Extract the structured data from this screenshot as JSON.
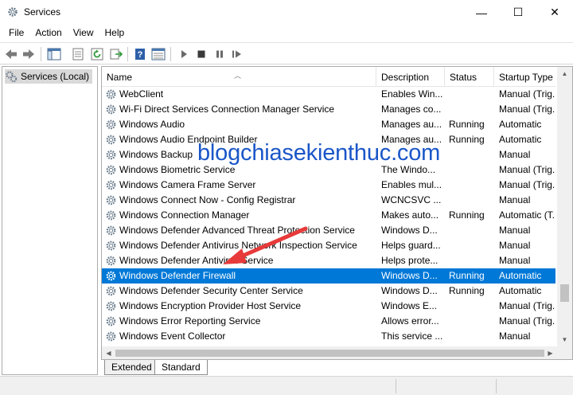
{
  "window": {
    "title": "Services",
    "icon": "gear-icon",
    "controls": {
      "minimize": "—",
      "maximize": "☐",
      "close": "✕"
    }
  },
  "menu": [
    "File",
    "Action",
    "View",
    "Help"
  ],
  "toolbar": {
    "icons": [
      "back-arrow-icon",
      "forward-arrow-icon",
      "show-hide-console-tree-icon",
      "properties-icon",
      "refresh-icon",
      "export-list-icon",
      "help-icon",
      "extended-view-icon",
      "start-service-icon",
      "stop-service-icon",
      "pause-service-icon",
      "restart-service-icon"
    ]
  },
  "tree": {
    "label": "Services (Local)"
  },
  "columns": [
    "Name",
    "Description",
    "Status",
    "Startup Type"
  ],
  "rows": [
    {
      "name": "WebClient",
      "description": "Enables Win...",
      "status": "",
      "startup": "Manual (Trig..."
    },
    {
      "name": "Wi-Fi Direct Services Connection Manager Service",
      "description": "Manages co...",
      "status": "",
      "startup": "Manual (Trig..."
    },
    {
      "name": "Windows Audio",
      "description": "Manages au...",
      "status": "Running",
      "startup": "Automatic"
    },
    {
      "name": "Windows Audio Endpoint Builder",
      "description": "Manages au...",
      "status": "Running",
      "startup": "Automatic"
    },
    {
      "name": "Windows Backup",
      "description": "",
      "status": "",
      "startup": "Manual"
    },
    {
      "name": "Windows Biometric Service",
      "description": "The Windo...",
      "status": "",
      "startup": "Manual (Trig..."
    },
    {
      "name": "Windows Camera Frame Server",
      "description": "Enables mul...",
      "status": "",
      "startup": "Manual (Trig..."
    },
    {
      "name": "Windows Connect Now - Config Registrar",
      "description": "WCNCSVC ...",
      "status": "",
      "startup": "Manual"
    },
    {
      "name": "Windows Connection Manager",
      "description": "Makes auto...",
      "status": "Running",
      "startup": "Automatic (T..."
    },
    {
      "name": "Windows Defender Advanced Threat Protection Service",
      "description": "Windows D...",
      "status": "",
      "startup": "Manual"
    },
    {
      "name": "Windows Defender Antivirus Network Inspection Service",
      "description": "Helps guard...",
      "status": "",
      "startup": "Manual"
    },
    {
      "name": "Windows Defender Antivirus Service",
      "description": "Helps prote...",
      "status": "",
      "startup": "Manual"
    },
    {
      "name": "Windows Defender Firewall",
      "description": "Windows D...",
      "status": "Running",
      "startup": "Automatic",
      "selected": true
    },
    {
      "name": "Windows Defender Security Center Service",
      "description": "Windows D...",
      "status": "Running",
      "startup": "Automatic"
    },
    {
      "name": "Windows Encryption Provider Host Service",
      "description": "Windows E...",
      "status": "",
      "startup": "Manual (Trig..."
    },
    {
      "name": "Windows Error Reporting Service",
      "description": "Allows error...",
      "status": "",
      "startup": "Manual (Trig..."
    },
    {
      "name": "Windows Event Collector",
      "description": "This service ...",
      "status": "",
      "startup": "Manual"
    }
  ],
  "tabs": [
    "Extended",
    "Standard"
  ],
  "active_tab": "Standard",
  "watermark": "blogchiasekienthuc.com",
  "colors": {
    "selection": "#0078d7",
    "watermark": "#1a56c8",
    "arrow": "#e83a3a"
  }
}
